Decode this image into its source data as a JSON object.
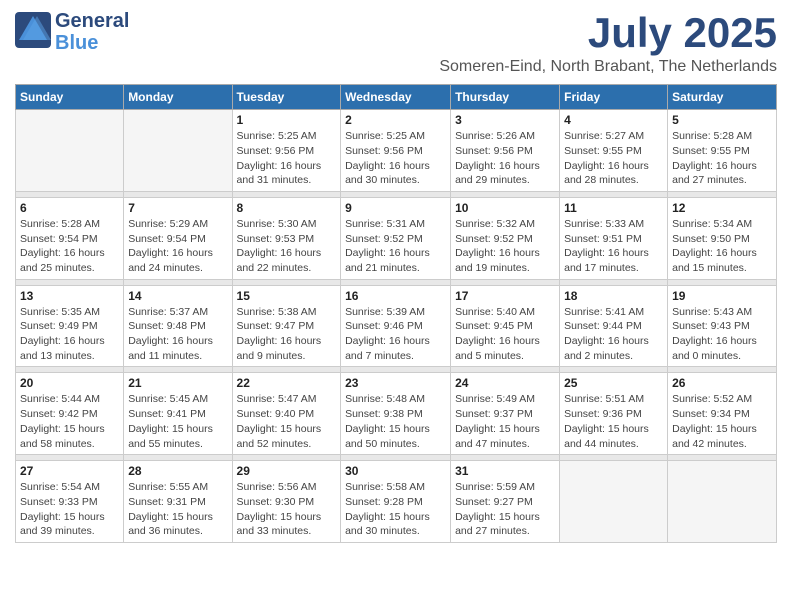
{
  "logo": {
    "line1": "General",
    "line2": "Blue"
  },
  "title": "July 2025",
  "location": "Someren-Eind, North Brabant, The Netherlands",
  "days_of_week": [
    "Sunday",
    "Monday",
    "Tuesday",
    "Wednesday",
    "Thursday",
    "Friday",
    "Saturday"
  ],
  "weeks": [
    {
      "days": [
        {
          "number": "",
          "info": ""
        },
        {
          "number": "",
          "info": ""
        },
        {
          "number": "1",
          "info": "Sunrise: 5:25 AM\nSunset: 9:56 PM\nDaylight: 16 hours\nand 31 minutes."
        },
        {
          "number": "2",
          "info": "Sunrise: 5:25 AM\nSunset: 9:56 PM\nDaylight: 16 hours\nand 30 minutes."
        },
        {
          "number": "3",
          "info": "Sunrise: 5:26 AM\nSunset: 9:56 PM\nDaylight: 16 hours\nand 29 minutes."
        },
        {
          "number": "4",
          "info": "Sunrise: 5:27 AM\nSunset: 9:55 PM\nDaylight: 16 hours\nand 28 minutes."
        },
        {
          "number": "5",
          "info": "Sunrise: 5:28 AM\nSunset: 9:55 PM\nDaylight: 16 hours\nand 27 minutes."
        }
      ]
    },
    {
      "days": [
        {
          "number": "6",
          "info": "Sunrise: 5:28 AM\nSunset: 9:54 PM\nDaylight: 16 hours\nand 25 minutes."
        },
        {
          "number": "7",
          "info": "Sunrise: 5:29 AM\nSunset: 9:54 PM\nDaylight: 16 hours\nand 24 minutes."
        },
        {
          "number": "8",
          "info": "Sunrise: 5:30 AM\nSunset: 9:53 PM\nDaylight: 16 hours\nand 22 minutes."
        },
        {
          "number": "9",
          "info": "Sunrise: 5:31 AM\nSunset: 9:52 PM\nDaylight: 16 hours\nand 21 minutes."
        },
        {
          "number": "10",
          "info": "Sunrise: 5:32 AM\nSunset: 9:52 PM\nDaylight: 16 hours\nand 19 minutes."
        },
        {
          "number": "11",
          "info": "Sunrise: 5:33 AM\nSunset: 9:51 PM\nDaylight: 16 hours\nand 17 minutes."
        },
        {
          "number": "12",
          "info": "Sunrise: 5:34 AM\nSunset: 9:50 PM\nDaylight: 16 hours\nand 15 minutes."
        }
      ]
    },
    {
      "days": [
        {
          "number": "13",
          "info": "Sunrise: 5:35 AM\nSunset: 9:49 PM\nDaylight: 16 hours\nand 13 minutes."
        },
        {
          "number": "14",
          "info": "Sunrise: 5:37 AM\nSunset: 9:48 PM\nDaylight: 16 hours\nand 11 minutes."
        },
        {
          "number": "15",
          "info": "Sunrise: 5:38 AM\nSunset: 9:47 PM\nDaylight: 16 hours\nand 9 minutes."
        },
        {
          "number": "16",
          "info": "Sunrise: 5:39 AM\nSunset: 9:46 PM\nDaylight: 16 hours\nand 7 minutes."
        },
        {
          "number": "17",
          "info": "Sunrise: 5:40 AM\nSunset: 9:45 PM\nDaylight: 16 hours\nand 5 minutes."
        },
        {
          "number": "18",
          "info": "Sunrise: 5:41 AM\nSunset: 9:44 PM\nDaylight: 16 hours\nand 2 minutes."
        },
        {
          "number": "19",
          "info": "Sunrise: 5:43 AM\nSunset: 9:43 PM\nDaylight: 16 hours\nand 0 minutes."
        }
      ]
    },
    {
      "days": [
        {
          "number": "20",
          "info": "Sunrise: 5:44 AM\nSunset: 9:42 PM\nDaylight: 15 hours\nand 58 minutes."
        },
        {
          "number": "21",
          "info": "Sunrise: 5:45 AM\nSunset: 9:41 PM\nDaylight: 15 hours\nand 55 minutes."
        },
        {
          "number": "22",
          "info": "Sunrise: 5:47 AM\nSunset: 9:40 PM\nDaylight: 15 hours\nand 52 minutes."
        },
        {
          "number": "23",
          "info": "Sunrise: 5:48 AM\nSunset: 9:38 PM\nDaylight: 15 hours\nand 50 minutes."
        },
        {
          "number": "24",
          "info": "Sunrise: 5:49 AM\nSunset: 9:37 PM\nDaylight: 15 hours\nand 47 minutes."
        },
        {
          "number": "25",
          "info": "Sunrise: 5:51 AM\nSunset: 9:36 PM\nDaylight: 15 hours\nand 44 minutes."
        },
        {
          "number": "26",
          "info": "Sunrise: 5:52 AM\nSunset: 9:34 PM\nDaylight: 15 hours\nand 42 minutes."
        }
      ]
    },
    {
      "days": [
        {
          "number": "27",
          "info": "Sunrise: 5:54 AM\nSunset: 9:33 PM\nDaylight: 15 hours\nand 39 minutes."
        },
        {
          "number": "28",
          "info": "Sunrise: 5:55 AM\nSunset: 9:31 PM\nDaylight: 15 hours\nand 36 minutes."
        },
        {
          "number": "29",
          "info": "Sunrise: 5:56 AM\nSunset: 9:30 PM\nDaylight: 15 hours\nand 33 minutes."
        },
        {
          "number": "30",
          "info": "Sunrise: 5:58 AM\nSunset: 9:28 PM\nDaylight: 15 hours\nand 30 minutes."
        },
        {
          "number": "31",
          "info": "Sunrise: 5:59 AM\nSunset: 9:27 PM\nDaylight: 15 hours\nand 27 minutes."
        },
        {
          "number": "",
          "info": ""
        },
        {
          "number": "",
          "info": ""
        }
      ]
    }
  ]
}
